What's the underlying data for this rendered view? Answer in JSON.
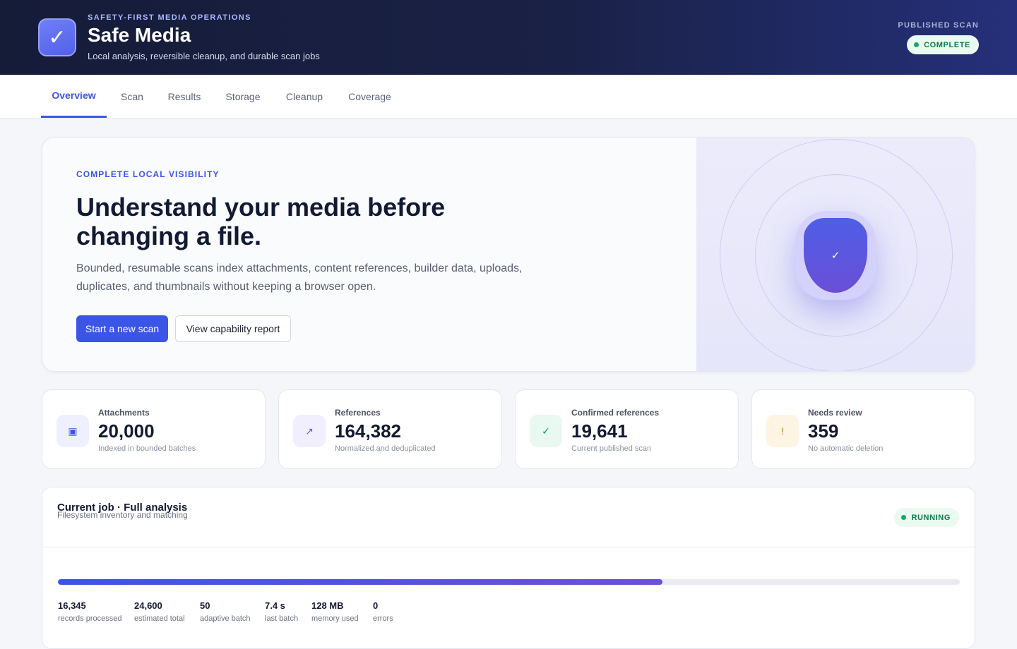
{
  "header": {
    "eyebrow": "SAFETY-FIRST MEDIA OPERATIONS",
    "title": "Safe Media",
    "subtitle": "Local analysis, reversible cleanup, and durable scan jobs",
    "logo_glyph": "✓",
    "published_label": "PUBLISHED SCAN",
    "published_status": "COMPLETE"
  },
  "tabs": [
    {
      "label": "Overview",
      "active": true
    },
    {
      "label": "Scan",
      "active": false
    },
    {
      "label": "Results",
      "active": false
    },
    {
      "label": "Storage",
      "active": false
    },
    {
      "label": "Cleanup",
      "active": false
    },
    {
      "label": "Coverage",
      "active": false
    }
  ],
  "hero": {
    "eyebrow": "COMPLETE LOCAL VISIBILITY",
    "title": "Understand your media before changing a file.",
    "description": "Bounded, resumable scans index attachments, content references, builder data, uploads, duplicates, and thumbnails without keeping a browser open.",
    "primary_button": "Start a new scan",
    "secondary_button": "View capability report",
    "shield_icon": "shield-check-icon",
    "shield_glyph": "✓"
  },
  "stats": [
    {
      "label": "Attachments",
      "value": "20,000",
      "note": "Indexed in bounded batches",
      "icon": "attachment-icon",
      "glyph": "▣",
      "icon_bg": "#eef0ff",
      "icon_color": "#3b55e6"
    },
    {
      "label": "References",
      "value": "164,382",
      "note": "Normalized and deduplicated",
      "icon": "link-arrow-icon",
      "glyph": "↗",
      "icon_bg": "#f1eefe",
      "icon_color": "#6b5bd6"
    },
    {
      "label": "Confirmed references",
      "value": "19,641",
      "note": "Current published scan",
      "icon": "checkmark-icon",
      "glyph": "✓",
      "icon_bg": "#e9f8f0",
      "icon_color": "#15955b"
    },
    {
      "label": "Needs review",
      "value": "359",
      "note": "No automatic deletion",
      "icon": "warning-icon",
      "glyph": "!",
      "icon_bg": "#fdf4e3",
      "icon_color": "#c98a12"
    }
  ],
  "job": {
    "title": "Current job · Full analysis",
    "subtitle": "Filesystem inventory and matching",
    "status": "RUNNING",
    "progress_fraction": 0.67,
    "metrics": [
      {
        "value": "16,345",
        "label": "records processed"
      },
      {
        "value": "24,600",
        "label": "estimated total"
      },
      {
        "value": "50",
        "label": "adaptive batch"
      },
      {
        "value": "7.4 s",
        "label": "last batch"
      },
      {
        "value": "128 MB",
        "label": "memory used"
      },
      {
        "value": "0",
        "label": "errors"
      }
    ]
  },
  "colors": {
    "accent": "#3b55e6",
    "header_bg": "#151c38",
    "success": "#14a866"
  }
}
